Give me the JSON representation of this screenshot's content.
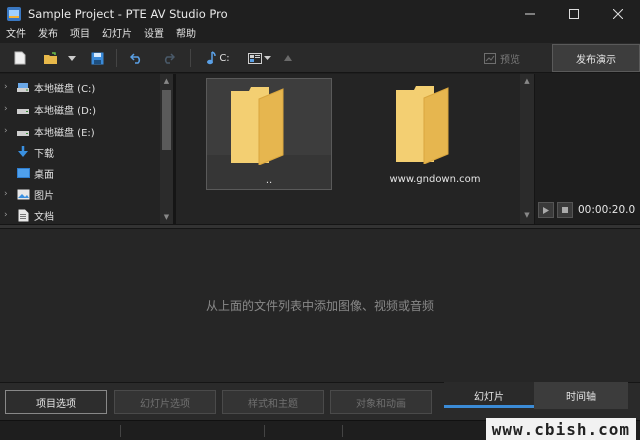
{
  "window": {
    "title": "Sample Project - PTE AV Studio Pro"
  },
  "menu": [
    "文件",
    "发布",
    "项目",
    "幻灯片",
    "设置",
    "帮助"
  ],
  "toolbar": {
    "music_drive": "C:",
    "preview_label": "预览",
    "publish_label": "发布演示"
  },
  "folder_tree": {
    "items": [
      {
        "label": "本地磁盘 (C:)",
        "icon": "drive-icon",
        "expandable": true
      },
      {
        "label": "本地磁盘 (D:)",
        "icon": "drive-icon",
        "expandable": true
      },
      {
        "label": "本地磁盘 (E:)",
        "icon": "drive-icon",
        "expandable": true
      },
      {
        "label": "下载",
        "icon": "download-icon",
        "expandable": false
      },
      {
        "label": "桌面",
        "icon": "desktop-icon",
        "expandable": false
      },
      {
        "label": "图片",
        "icon": "pictures-icon",
        "expandable": true
      },
      {
        "label": "文档",
        "icon": "documents-icon",
        "expandable": true
      }
    ]
  },
  "file_list": {
    "items": [
      {
        "label": "..",
        "selected": true
      },
      {
        "label": "www.gndown.com",
        "selected": false
      }
    ]
  },
  "preview": {
    "timecode": "00:00:20.0"
  },
  "slides": {
    "empty_hint": "从上面的文件列表中添加图像、视频或音频"
  },
  "bottom_buttons": [
    {
      "label": "项目选项",
      "enabled": true
    },
    {
      "label": "幻灯片选项",
      "enabled": false
    },
    {
      "label": "样式和主题",
      "enabled": false
    },
    {
      "label": "对象和动画",
      "enabled": false
    }
  ],
  "mode_tabs": [
    {
      "label": "幻灯片",
      "selected": true
    },
    {
      "label": "时间轴",
      "selected": false
    }
  ],
  "watermark": "www.cbish.com",
  "colors": {
    "accent": "#3b8bd6",
    "folder": "#f3cf72"
  }
}
